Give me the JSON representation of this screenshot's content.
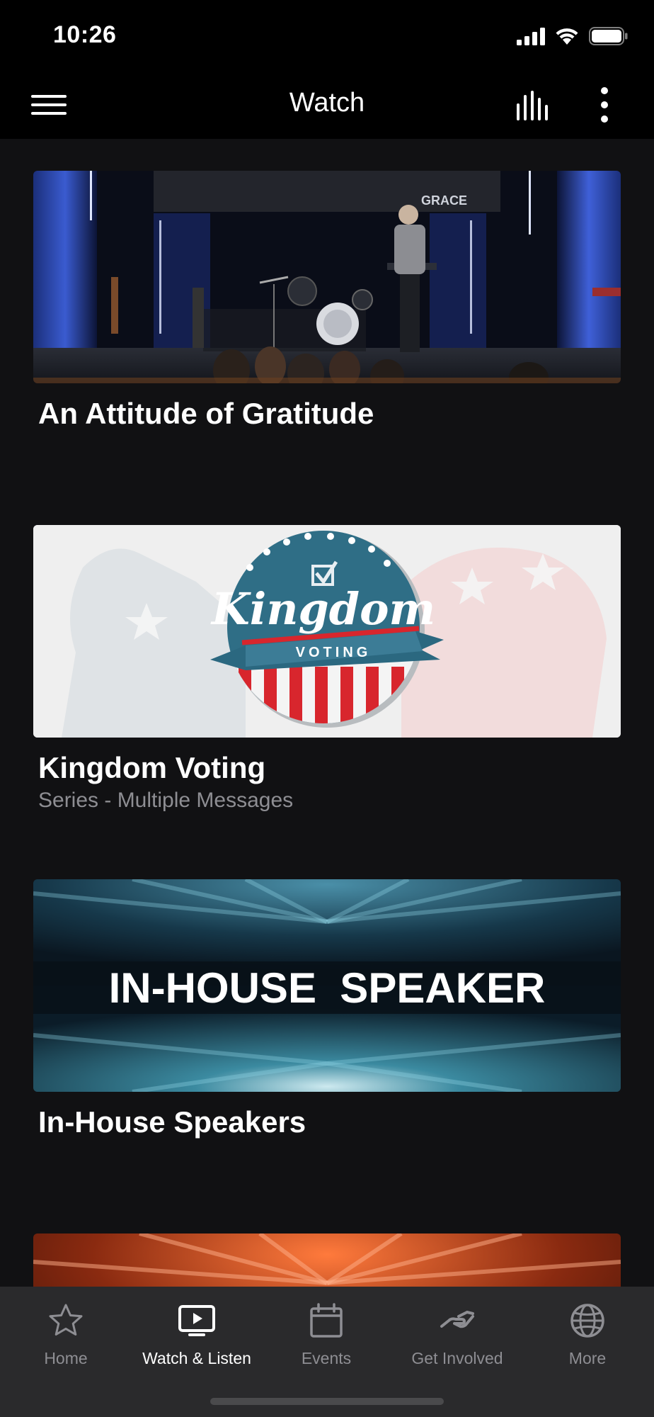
{
  "status_bar": {
    "time": "10:26"
  },
  "header": {
    "title": "Watch"
  },
  "items": [
    {
      "title": "An Attitude of Gratitude",
      "subtitle": "",
      "thumbnail": {
        "badge": "GRACE"
      }
    },
    {
      "title": "Kingdom Voting",
      "subtitle": "Series - Multiple Messages",
      "thumbnail": {
        "logo_word": "Kingdom",
        "logo_banner": "VOTING"
      }
    },
    {
      "title": "In-House Speakers",
      "subtitle": "",
      "thumbnail": {
        "headline": "IN-HOUSE  SPEAKER"
      }
    }
  ],
  "tabs": [
    {
      "label": "Home",
      "icon": "star-icon",
      "active": false
    },
    {
      "label": "Watch & Listen",
      "icon": "play-screen-icon",
      "active": true
    },
    {
      "label": "Events",
      "icon": "calendar-icon",
      "active": false
    },
    {
      "label": "Get Involved",
      "icon": "handshake-icon",
      "active": false
    },
    {
      "label": "More",
      "icon": "globe-icon",
      "active": false
    }
  ],
  "colors": {
    "background": "#111113",
    "nav_background": "#000000",
    "tab_bar": "#2a2a2c",
    "inactive": "#8e8e93",
    "active": "#ffffff"
  }
}
